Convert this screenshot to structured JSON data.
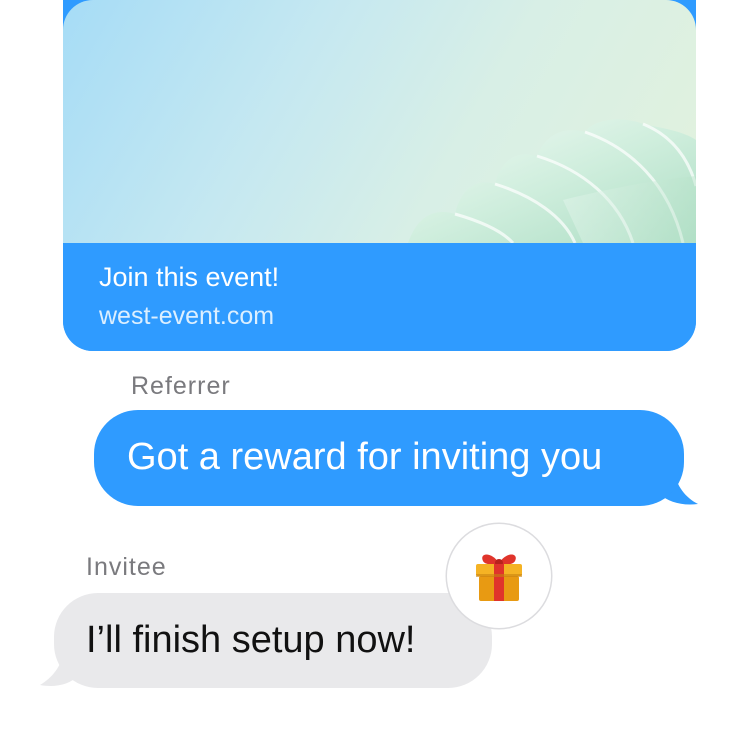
{
  "link_preview": {
    "title": "Join this event!",
    "url": "west-event.com",
    "image": "abstract-wave-image"
  },
  "messages": [
    {
      "sender": "Referrer",
      "direction": "outgoing",
      "text": "Got a reward for inviting you"
    },
    {
      "sender": "Invitee",
      "direction": "incoming",
      "text": "I’ll finish setup now!",
      "reaction": "gift-icon"
    }
  ],
  "colors": {
    "outgoing_bubble": "#2f9bff",
    "incoming_bubble": "#e9e9eb",
    "sender_label": "#7a7a7e"
  }
}
